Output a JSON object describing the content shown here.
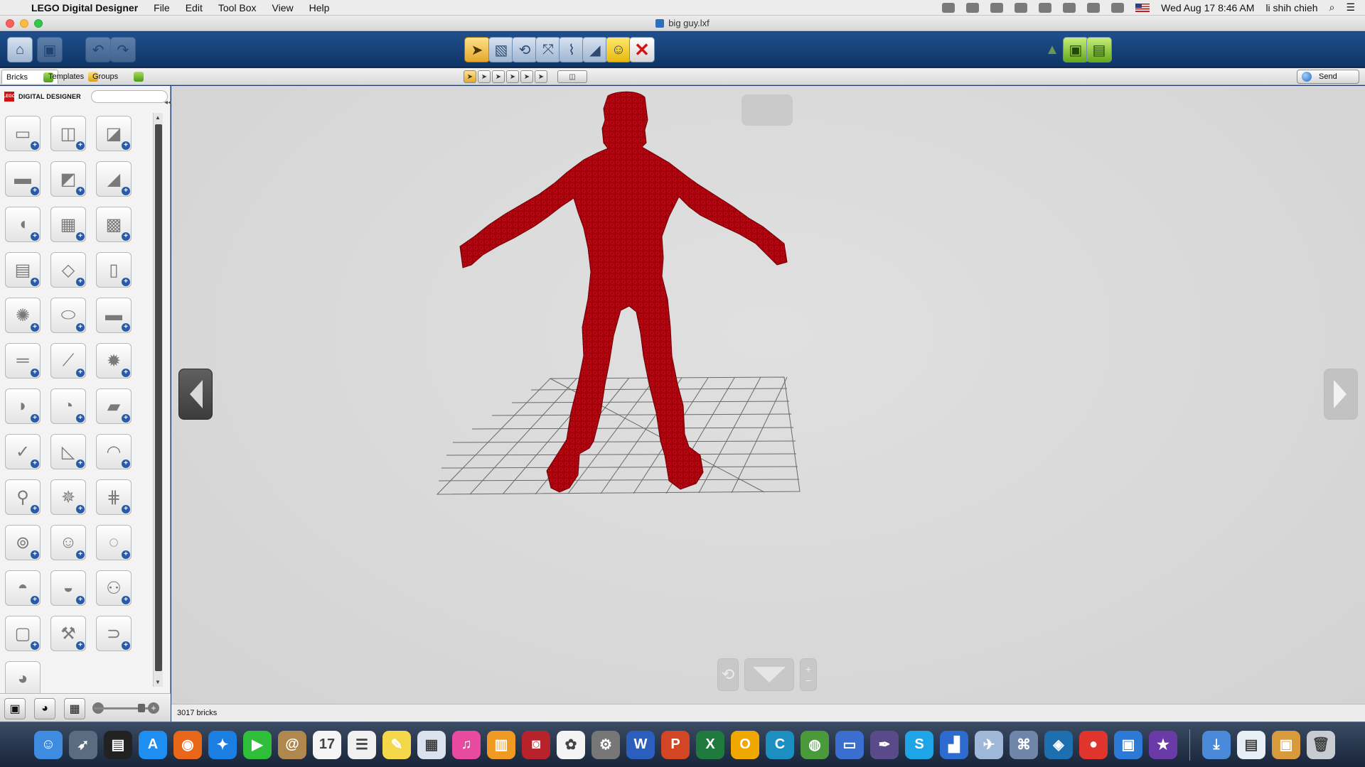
{
  "menubar": {
    "apple": "",
    "app_name": "LEGO Digital Designer",
    "menus": [
      "File",
      "Edit",
      "Tool Box",
      "View",
      "Help"
    ],
    "clock": "Wed Aug 17  8:46 AM",
    "user": "li shih chieh"
  },
  "window": {
    "title": "big guy.lxf"
  },
  "subbar": {
    "tabs": [
      "Bricks",
      "Templates",
      "Groups"
    ],
    "send_label": "Send"
  },
  "sidebar": {
    "logo_text": "LEGO",
    "brand_label": "DIGITAL DESIGNER",
    "search_value": "",
    "bricks": [
      "brick-2x4",
      "brick-2x2-round",
      "brick-slope-corner",
      "brick-2x6",
      "slope-2x2",
      "slope-long",
      "brick-curved",
      "plate-2x2",
      "plate-2x3",
      "plate-technic",
      "plate-modified",
      "door-panel",
      "gear-wheel",
      "technic-cylinder",
      "technic-beam",
      "technic-liftarm",
      "technic-axle",
      "gear-large",
      "wing-plate",
      "cylinder-round",
      "wedge-plate",
      "technic-connector",
      "slide-plate",
      "arch-piece",
      "bar-holder",
      "steering-wheel",
      "track-piece",
      "propeller",
      "minifig",
      "minifig-head",
      "helmet",
      "hat",
      "skeleton",
      "accessory-bag",
      "tool-hammer",
      "clip-piece",
      "animal-piece"
    ]
  },
  "viewport": {
    "brick_color": "#a8000a",
    "grid_color": "#666666"
  },
  "status": {
    "brick_count": "3017 bricks"
  },
  "dock": {
    "apps": [
      {
        "name": "finder",
        "glyph": "☺",
        "color": "#3f8be0"
      },
      {
        "name": "launchpad",
        "glyph": "➶",
        "color": "#5b6b80"
      },
      {
        "name": "activity-monitor",
        "glyph": "▤",
        "color": "#222222"
      },
      {
        "name": "app-store",
        "glyph": "A",
        "color": "#1e8ef0"
      },
      {
        "name": "firefox",
        "glyph": "◉",
        "color": "#e8671a"
      },
      {
        "name": "safari",
        "glyph": "✦",
        "color": "#1a7fe0"
      },
      {
        "name": "facetime",
        "glyph": "▶",
        "color": "#2fbe3a"
      },
      {
        "name": "contacts",
        "glyph": "@",
        "color": "#b0884e"
      },
      {
        "name": "calendar",
        "glyph": "17",
        "color": "#f5f5f5"
      },
      {
        "name": "reminders",
        "glyph": "☰",
        "color": "#f0f0f0"
      },
      {
        "name": "notes",
        "glyph": "✎",
        "color": "#f4d84a"
      },
      {
        "name": "preview",
        "glyph": "▦",
        "color": "#d9e2ee"
      },
      {
        "name": "itunes",
        "glyph": "♫",
        "color": "#e84a9f"
      },
      {
        "name": "ibooks",
        "glyph": "▥",
        "color": "#f09a24"
      },
      {
        "name": "photo-booth",
        "glyph": "◙",
        "color": "#b8232b"
      },
      {
        "name": "photos",
        "glyph": "✿",
        "color": "#f4f4f4"
      },
      {
        "name": "system-preferences",
        "glyph": "⚙",
        "color": "#777777"
      },
      {
        "name": "word",
        "glyph": "W",
        "color": "#2b5fbd"
      },
      {
        "name": "powerpoint",
        "glyph": "P",
        "color": "#d24625"
      },
      {
        "name": "excel",
        "glyph": "X",
        "color": "#1f7a3d"
      },
      {
        "name": "outlook",
        "glyph": "O",
        "color": "#f0a800"
      },
      {
        "name": "c-app",
        "glyph": "C",
        "color": "#1c8fc0"
      },
      {
        "name": "globe-app",
        "glyph": "◍",
        "color": "#4a9a3c"
      },
      {
        "name": "keynote",
        "glyph": "▭",
        "color": "#3a6fcf"
      },
      {
        "name": "pen-tool",
        "glyph": "✒",
        "color": "#5a4a8a"
      },
      {
        "name": "skype",
        "glyph": "S",
        "color": "#1ea5e8"
      },
      {
        "name": "chart-app",
        "glyph": "▟",
        "color": "#2e6bd1"
      },
      {
        "name": "preview-2",
        "glyph": "✈",
        "color": "#9fb8d8"
      },
      {
        "name": "network-app",
        "glyph": "⌘",
        "color": "#6f86a8"
      },
      {
        "name": "design-app",
        "glyph": "◈",
        "color": "#1e6fb0"
      },
      {
        "name": "chrome",
        "glyph": "●",
        "color": "#e0352d"
      },
      {
        "name": "lego-digital-designer",
        "glyph": "▣",
        "color": "#2c7ad6"
      },
      {
        "name": "imovie",
        "glyph": "★",
        "color": "#6a3aa8"
      }
    ],
    "right_apps": [
      {
        "name": "downloads-stack",
        "glyph": "⤓",
        "color": "#4a8ad8"
      },
      {
        "name": "documents-stack",
        "glyph": "▤",
        "color": "#e8eef6"
      },
      {
        "name": "package-app",
        "glyph": "▣",
        "color": "#d89a3a"
      },
      {
        "name": "trash",
        "glyph": "🗑",
        "color": "#c8ccd2"
      }
    ]
  }
}
